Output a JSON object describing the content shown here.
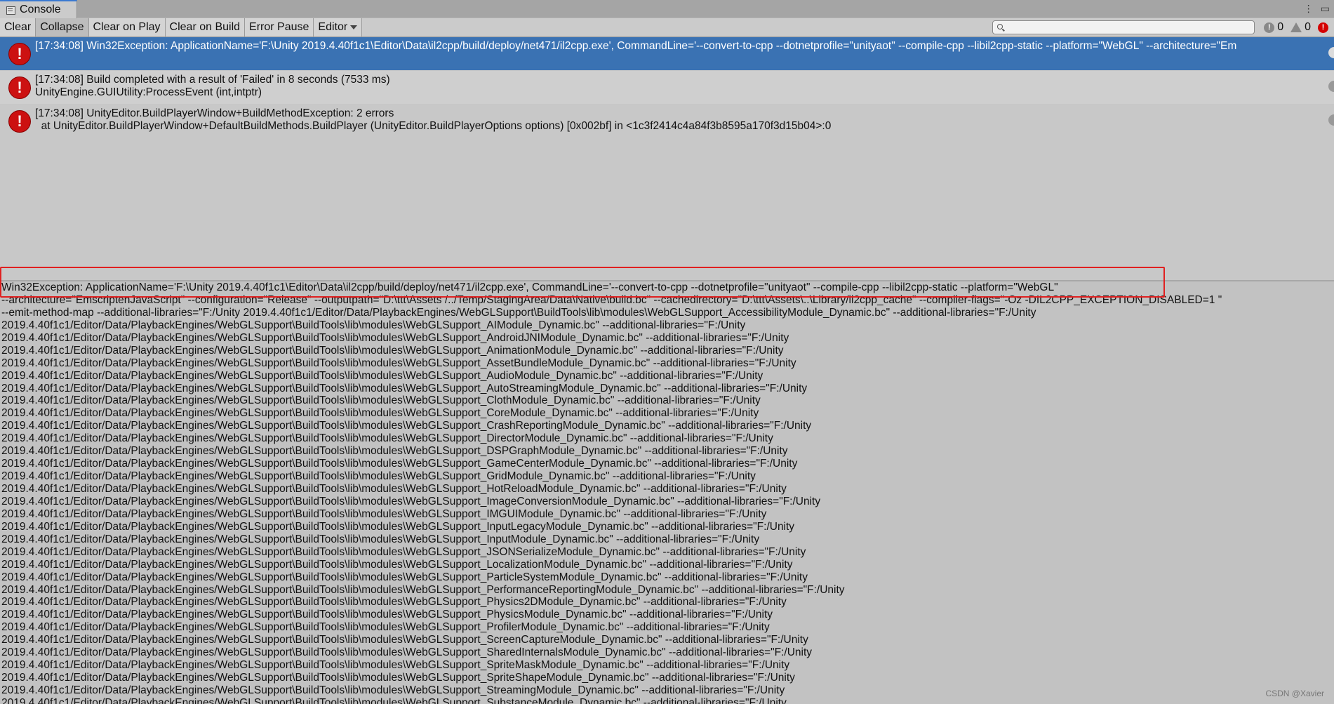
{
  "window": {
    "tab_title": "Console"
  },
  "toolbar": {
    "buttons": [
      "Clear",
      "Collapse",
      "Clear on Play",
      "Clear on Build",
      "Error Pause"
    ],
    "editor_dropdown": "Editor",
    "search_value": "",
    "counts": {
      "info": "0",
      "warning": "0",
      "error": ""
    }
  },
  "logs": [
    {
      "line1": "[17:34:08] Win32Exception: ApplicationName='F:\\Unity 2019.4.40f1c1\\Editor\\Data\\il2cpp/build/deploy/net471/il2cpp.exe', CommandLine='--convert-to-cpp --dotnetprofile=\"unityaot\" --compile-cpp --libil2cpp-static --platform=\"WebGL\" --architecture=\"Em",
      "line2": "",
      "selected": true
    },
    {
      "line1": "[17:34:08] Build completed with a result of 'Failed' in 8 seconds (7533 ms)",
      "line2": "UnityEngine.GUIUtility:ProcessEvent (int,intptr)",
      "selected": false
    },
    {
      "line1": "[17:34:08] UnityEditor.BuildPlayerWindow+BuildMethodException: 2 errors",
      "line2": "  at UnityEditor.BuildPlayerWindow+DefaultBuildMethods.BuildPlayer (UnityEditor.BuildPlayerOptions options) [0x002bf] in <1c3f2414c4a84f3b8595a170f3d15b04>:0",
      "selected": false
    }
  ],
  "detail_lines": [
    "Win32Exception: ApplicationName='F:\\Unity 2019.4.40f1c1\\Editor\\Data\\il2cpp/build/deploy/net471/il2cpp.exe', CommandLine='--convert-to-cpp --dotnetprofile=\"unityaot\" --compile-cpp --libil2cpp-static --platform=\"WebGL\"",
    "--architecture=\"EmscriptenJavaScript\" --configuration=\"Release\" --outputpath=\"D:\\ttt\\Assets /../Temp/StagingArea/Data\\Native\\build.bc\" --cachedirectory=\"D:\\ttt\\Assets\\..\\Library/il2cpp_cache\" --compiler-flags=\"-Oz -DIL2CPP_EXCEPTION_DISABLED=1 \"",
    "--emit-method-map --additional-libraries=\"F:/Unity 2019.4.40f1c1/Editor/Data/PlaybackEngines/WebGLSupport\\BuildTools\\lib\\modules\\WebGLSupport_AccessibilityModule_Dynamic.bc\" --additional-libraries=\"F:/Unity",
    "2019.4.40f1c1/Editor/Data/PlaybackEngines/WebGLSupport\\BuildTools\\lib\\modules\\WebGLSupport_AIModule_Dynamic.bc\" --additional-libraries=\"F:/Unity",
    "2019.4.40f1c1/Editor/Data/PlaybackEngines/WebGLSupport\\BuildTools\\lib\\modules\\WebGLSupport_AndroidJNIModule_Dynamic.bc\" --additional-libraries=\"F:/Unity",
    "2019.4.40f1c1/Editor/Data/PlaybackEngines/WebGLSupport\\BuildTools\\lib\\modules\\WebGLSupport_AnimationModule_Dynamic.bc\" --additional-libraries=\"F:/Unity",
    "2019.4.40f1c1/Editor/Data/PlaybackEngines/WebGLSupport\\BuildTools\\lib\\modules\\WebGLSupport_AssetBundleModule_Dynamic.bc\" --additional-libraries=\"F:/Unity",
    "2019.4.40f1c1/Editor/Data/PlaybackEngines/WebGLSupport\\BuildTools\\lib\\modules\\WebGLSupport_AudioModule_Dynamic.bc\" --additional-libraries=\"F:/Unity",
    "2019.4.40f1c1/Editor/Data/PlaybackEngines/WebGLSupport\\BuildTools\\lib\\modules\\WebGLSupport_AutoStreamingModule_Dynamic.bc\" --additional-libraries=\"F:/Unity",
    "2019.4.40f1c1/Editor/Data/PlaybackEngines/WebGLSupport\\BuildTools\\lib\\modules\\WebGLSupport_ClothModule_Dynamic.bc\" --additional-libraries=\"F:/Unity",
    "2019.4.40f1c1/Editor/Data/PlaybackEngines/WebGLSupport\\BuildTools\\lib\\modules\\WebGLSupport_CoreModule_Dynamic.bc\" --additional-libraries=\"F:/Unity",
    "2019.4.40f1c1/Editor/Data/PlaybackEngines/WebGLSupport\\BuildTools\\lib\\modules\\WebGLSupport_CrashReportingModule_Dynamic.bc\" --additional-libraries=\"F:/Unity",
    "2019.4.40f1c1/Editor/Data/PlaybackEngines/WebGLSupport\\BuildTools\\lib\\modules\\WebGLSupport_DirectorModule_Dynamic.bc\" --additional-libraries=\"F:/Unity",
    "2019.4.40f1c1/Editor/Data/PlaybackEngines/WebGLSupport\\BuildTools\\lib\\modules\\WebGLSupport_DSPGraphModule_Dynamic.bc\" --additional-libraries=\"F:/Unity",
    "2019.4.40f1c1/Editor/Data/PlaybackEngines/WebGLSupport\\BuildTools\\lib\\modules\\WebGLSupport_GameCenterModule_Dynamic.bc\" --additional-libraries=\"F:/Unity",
    "2019.4.40f1c1/Editor/Data/PlaybackEngines/WebGLSupport\\BuildTools\\lib\\modules\\WebGLSupport_GridModule_Dynamic.bc\" --additional-libraries=\"F:/Unity",
    "2019.4.40f1c1/Editor/Data/PlaybackEngines/WebGLSupport\\BuildTools\\lib\\modules\\WebGLSupport_HotReloadModule_Dynamic.bc\" --additional-libraries=\"F:/Unity",
    "2019.4.40f1c1/Editor/Data/PlaybackEngines/WebGLSupport\\BuildTools\\lib\\modules\\WebGLSupport_ImageConversionModule_Dynamic.bc\" --additional-libraries=\"F:/Unity",
    "2019.4.40f1c1/Editor/Data/PlaybackEngines/WebGLSupport\\BuildTools\\lib\\modules\\WebGLSupport_IMGUIModule_Dynamic.bc\" --additional-libraries=\"F:/Unity",
    "2019.4.40f1c1/Editor/Data/PlaybackEngines/WebGLSupport\\BuildTools\\lib\\modules\\WebGLSupport_InputLegacyModule_Dynamic.bc\" --additional-libraries=\"F:/Unity",
    "2019.4.40f1c1/Editor/Data/PlaybackEngines/WebGLSupport\\BuildTools\\lib\\modules\\WebGLSupport_InputModule_Dynamic.bc\" --additional-libraries=\"F:/Unity",
    "2019.4.40f1c1/Editor/Data/PlaybackEngines/WebGLSupport\\BuildTools\\lib\\modules\\WebGLSupport_JSONSerializeModule_Dynamic.bc\" --additional-libraries=\"F:/Unity",
    "2019.4.40f1c1/Editor/Data/PlaybackEngines/WebGLSupport\\BuildTools\\lib\\modules\\WebGLSupport_LocalizationModule_Dynamic.bc\" --additional-libraries=\"F:/Unity",
    "2019.4.40f1c1/Editor/Data/PlaybackEngines/WebGLSupport\\BuildTools\\lib\\modules\\WebGLSupport_ParticleSystemModule_Dynamic.bc\" --additional-libraries=\"F:/Unity",
    "2019.4.40f1c1/Editor/Data/PlaybackEngines/WebGLSupport\\BuildTools\\lib\\modules\\WebGLSupport_PerformanceReportingModule_Dynamic.bc\" --additional-libraries=\"F:/Unity",
    "2019.4.40f1c1/Editor/Data/PlaybackEngines/WebGLSupport\\BuildTools\\lib\\modules\\WebGLSupport_Physics2DModule_Dynamic.bc\" --additional-libraries=\"F:/Unity",
    "2019.4.40f1c1/Editor/Data/PlaybackEngines/WebGLSupport\\BuildTools\\lib\\modules\\WebGLSupport_PhysicsModule_Dynamic.bc\" --additional-libraries=\"F:/Unity",
    "2019.4.40f1c1/Editor/Data/PlaybackEngines/WebGLSupport\\BuildTools\\lib\\modules\\WebGLSupport_ProfilerModule_Dynamic.bc\" --additional-libraries=\"F:/Unity",
    "2019.4.40f1c1/Editor/Data/PlaybackEngines/WebGLSupport\\BuildTools\\lib\\modules\\WebGLSupport_ScreenCaptureModule_Dynamic.bc\" --additional-libraries=\"F:/Unity",
    "2019.4.40f1c1/Editor/Data/PlaybackEngines/WebGLSupport\\BuildTools\\lib\\modules\\WebGLSupport_SharedInternalsModule_Dynamic.bc\" --additional-libraries=\"F:/Unity",
    "2019.4.40f1c1/Editor/Data/PlaybackEngines/WebGLSupport\\BuildTools\\lib\\modules\\WebGLSupport_SpriteMaskModule_Dynamic.bc\" --additional-libraries=\"F:/Unity",
    "2019.4.40f1c1/Editor/Data/PlaybackEngines/WebGLSupport\\BuildTools\\lib\\modules\\WebGLSupport_SpriteShapeModule_Dynamic.bc\" --additional-libraries=\"F:/Unity",
    "2019.4.40f1c1/Editor/Data/PlaybackEngines/WebGLSupport\\BuildTools\\lib\\modules\\WebGLSupport_StreamingModule_Dynamic.bc\" --additional-libraries=\"F:/Unity",
    "2019.4.40f1c1/Editor/Data/PlaybackEngines/WebGLSupport\\BuildTools\\lib\\modules\\WebGLSupport_SubstanceModule_Dynamic.bc\" --additional-libraries=\"F:/Unity"
  ],
  "watermark": "CSDN @Xavier"
}
